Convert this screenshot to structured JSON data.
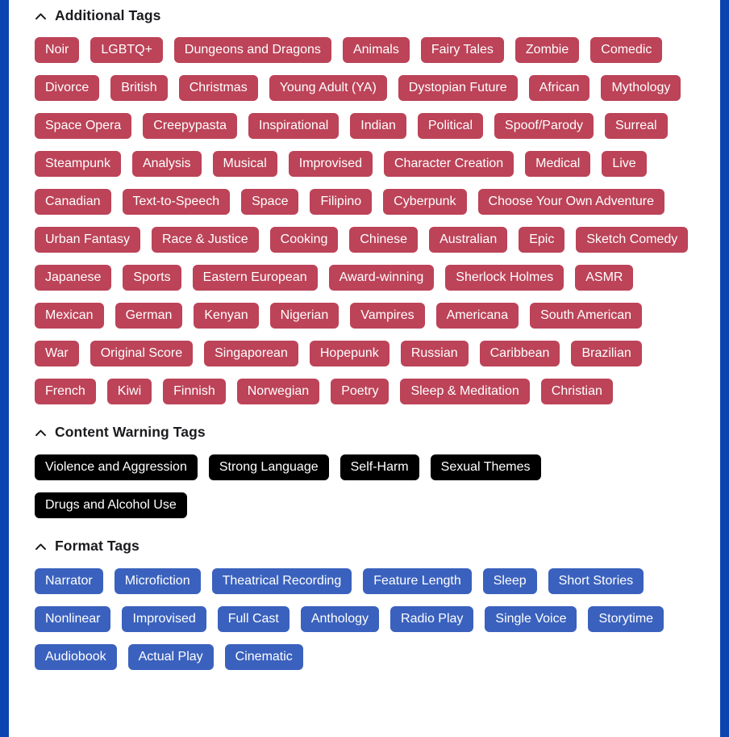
{
  "theme": {
    "frame_border_color": "#0a44b0",
    "background_color": "#ffffff",
    "additional_tag_color": "#bc4358",
    "warning_tag_color": "#000000",
    "format_tag_color": "#3a61bd",
    "heading_color": "#1b1b1f"
  },
  "sections": [
    {
      "id": "additional-tags",
      "title": "Additional Tags",
      "collapse_icon": "chevron-up-icon",
      "expanded": true,
      "tag_style": "additional",
      "tags": [
        "Noir",
        "LGBTQ+",
        "Dungeons and Dragons",
        "Animals",
        "Fairy Tales",
        "Zombie",
        "Comedic",
        "Divorce",
        "British",
        "Christmas",
        "Young Adult (YA)",
        "Dystopian Future",
        "African",
        "Mythology",
        "Space Opera",
        "Creepypasta",
        "Inspirational",
        "Indian",
        "Political",
        "Spoof/Parody",
        "Surreal",
        "Steampunk",
        "Analysis",
        "Musical",
        "Improvised",
        "Character Creation",
        "Medical",
        "Live",
        "Canadian",
        "Text-to-Speech",
        "Space",
        "Filipino",
        "Cyberpunk",
        "Choose Your Own Adventure",
        "Urban Fantasy",
        "Race & Justice",
        "Cooking",
        "Chinese",
        "Australian",
        "Epic",
        "Sketch Comedy",
        "Japanese",
        "Sports",
        "Eastern European",
        "Award-winning",
        "Sherlock Holmes",
        "ASMR",
        "Mexican",
        "German",
        "Kenyan",
        "Nigerian",
        "Vampires",
        "Americana",
        "South American",
        "War",
        "Original Score",
        "Singaporean",
        "Hopepunk",
        "Russian",
        "Caribbean",
        "Brazilian",
        "French",
        "Kiwi",
        "Finnish",
        "Norwegian",
        "Poetry",
        "Sleep & Meditation",
        "Christian"
      ]
    },
    {
      "id": "content-warning-tags",
      "title": "Content Warning Tags",
      "collapse_icon": "chevron-up-icon",
      "expanded": true,
      "tag_style": "warning",
      "tags": [
        "Violence and Aggression",
        "Strong Language",
        "Self-Harm",
        "Sexual Themes",
        "Drugs and Alcohol Use"
      ]
    },
    {
      "id": "format-tags",
      "title": "Format Tags",
      "collapse_icon": "chevron-up-icon",
      "expanded": true,
      "tag_style": "format",
      "tags": [
        "Narrator",
        "Microfiction",
        "Theatrical Recording",
        "Feature Length",
        "Sleep",
        "Short Stories",
        "Nonlinear",
        "Improvised",
        "Full Cast",
        "Anthology",
        "Radio Play",
        "Single Voice",
        "Storytime",
        "Audiobook",
        "Actual Play",
        "Cinematic"
      ]
    }
  ]
}
